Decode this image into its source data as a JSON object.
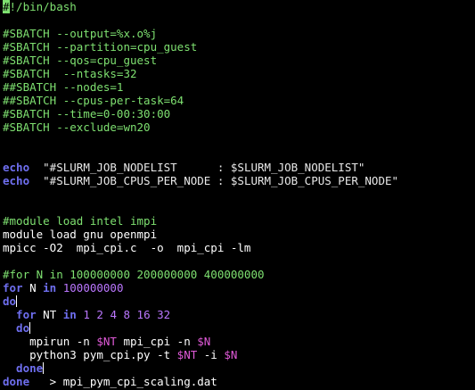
{
  "editor": {
    "lines": [
      {
        "segments": [
          {
            "text": "#!/bin/bash",
            "cls": "comment"
          }
        ]
      },
      {
        "segments": []
      },
      {
        "segments": [
          {
            "text": "#SBATCH --output=%x.o%j",
            "cls": "comment"
          }
        ]
      },
      {
        "segments": [
          {
            "text": "#SBATCH --partition=cpu_guest",
            "cls": "comment"
          }
        ]
      },
      {
        "segments": [
          {
            "text": "#SBATCH --qos=cpu_guest",
            "cls": "comment"
          }
        ]
      },
      {
        "segments": [
          {
            "text": "#SBATCH  --ntasks=32",
            "cls": "comment"
          }
        ]
      },
      {
        "segments": [
          {
            "text": "##SBATCH --nodes=1",
            "cls": "comment"
          }
        ]
      },
      {
        "segments": [
          {
            "text": "##SBATCH --cpus-per-task=64",
            "cls": "comment"
          }
        ]
      },
      {
        "segments": [
          {
            "text": "#SBATCH --time=0-00:30:00",
            "cls": "comment"
          }
        ]
      },
      {
        "segments": [
          {
            "text": "#SBATCH --exclude=wn20",
            "cls": "comment"
          }
        ]
      },
      {
        "segments": []
      },
      {
        "segments": []
      },
      {
        "segments": [
          {
            "text": "echo",
            "cls": "keyword"
          },
          {
            "text": "  \"#SLURM_JOB_NODELIST      : ",
            "cls": "string"
          },
          {
            "text": "$SLURM_JOB_NODELIST",
            "cls": "string"
          },
          {
            "text": "\"",
            "cls": "string"
          }
        ]
      },
      {
        "segments": [
          {
            "text": "echo",
            "cls": "keyword"
          },
          {
            "text": "  \"#SLURM_JOB_CPUS_PER_NODE : ",
            "cls": "string"
          },
          {
            "text": "$SLURM_JOB_CPUS_PER_NODE",
            "cls": "string"
          },
          {
            "text": "\"",
            "cls": "string"
          }
        ]
      },
      {
        "segments": []
      },
      {
        "segments": []
      },
      {
        "segments": [
          {
            "text": "#module load intel impi",
            "cls": "comment"
          }
        ]
      },
      {
        "segments": [
          {
            "text": "module load gnu openmpi",
            "cls": "plain"
          }
        ]
      },
      {
        "segments": [
          {
            "text": "mpicc -O2  mpi_cpi.c  -o  mpi_cpi -lm",
            "cls": "plain"
          }
        ]
      },
      {
        "segments": []
      },
      {
        "segments": [
          {
            "text": "#for N in 100000000 200000000 400000000",
            "cls": "comment"
          }
        ]
      },
      {
        "segments": [
          {
            "text": "for",
            "cls": "keyword"
          },
          {
            "text": " N ",
            "cls": "plain"
          },
          {
            "text": "in",
            "cls": "keyword"
          },
          {
            "text": " 100000000",
            "cls": "number"
          }
        ]
      },
      {
        "segments": [
          {
            "text": "do",
            "cls": "keyword"
          }
        ],
        "cursor": "bar"
      },
      {
        "segments": [
          {
            "text": "  for",
            "cls": "keyword"
          },
          {
            "text": " NT ",
            "cls": "plain"
          },
          {
            "text": "in",
            "cls": "keyword"
          },
          {
            "text": " 1 2 4 8 16 32",
            "cls": "number"
          }
        ]
      },
      {
        "segments": [
          {
            "text": "  do",
            "cls": "keyword"
          }
        ],
        "cursor": "bar"
      },
      {
        "segments": [
          {
            "text": "    mpirun -n ",
            "cls": "plain"
          },
          {
            "text": "$NT",
            "cls": "var"
          },
          {
            "text": " mpi_cpi -n ",
            "cls": "plain"
          },
          {
            "text": "$N",
            "cls": "var"
          }
        ]
      },
      {
        "segments": [
          {
            "text": "    python3 pym_cpi.py -t ",
            "cls": "plain"
          },
          {
            "text": "$NT",
            "cls": "var"
          },
          {
            "text": " -i ",
            "cls": "plain"
          },
          {
            "text": "$N",
            "cls": "var"
          }
        ]
      },
      {
        "segments": [
          {
            "text": "  done",
            "cls": "keyword"
          }
        ],
        "cursor": "bar"
      },
      {
        "segments": [
          {
            "text": "done",
            "cls": "keyword"
          },
          {
            "text": "   > mpi_pym_cpi_scaling.dat",
            "cls": "plain"
          }
        ]
      }
    ]
  },
  "colors": {
    "background": "#000000",
    "comment": "#7ee070",
    "keyword": "#6f6ff0",
    "variable": "#e05ad8",
    "text": "#ffffff"
  }
}
